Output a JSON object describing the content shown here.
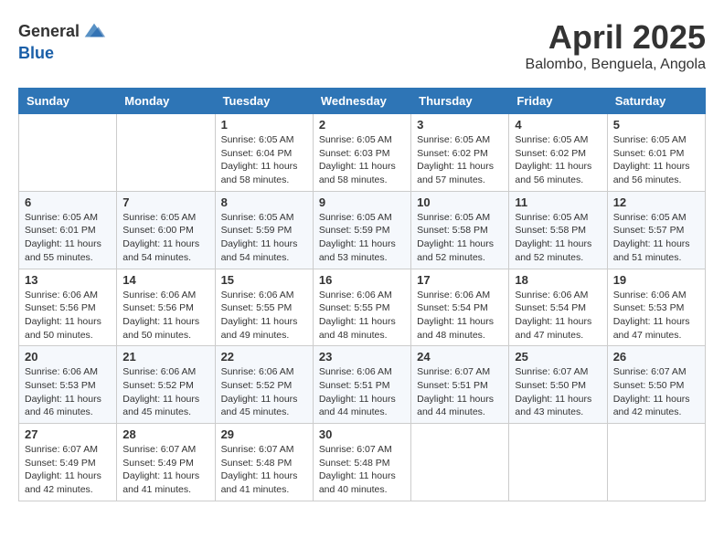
{
  "header": {
    "logo_general": "General",
    "logo_blue": "Blue",
    "month_title": "April 2025",
    "subtitle": "Balombo, Benguela, Angola"
  },
  "days_of_week": [
    "Sunday",
    "Monday",
    "Tuesday",
    "Wednesday",
    "Thursday",
    "Friday",
    "Saturday"
  ],
  "weeks": [
    [
      {
        "day": "",
        "info": ""
      },
      {
        "day": "",
        "info": ""
      },
      {
        "day": "1",
        "info": "Sunrise: 6:05 AM\nSunset: 6:04 PM\nDaylight: 11 hours and 58 minutes."
      },
      {
        "day": "2",
        "info": "Sunrise: 6:05 AM\nSunset: 6:03 PM\nDaylight: 11 hours and 58 minutes."
      },
      {
        "day": "3",
        "info": "Sunrise: 6:05 AM\nSunset: 6:02 PM\nDaylight: 11 hours and 57 minutes."
      },
      {
        "day": "4",
        "info": "Sunrise: 6:05 AM\nSunset: 6:02 PM\nDaylight: 11 hours and 56 minutes."
      },
      {
        "day": "5",
        "info": "Sunrise: 6:05 AM\nSunset: 6:01 PM\nDaylight: 11 hours and 56 minutes."
      }
    ],
    [
      {
        "day": "6",
        "info": "Sunrise: 6:05 AM\nSunset: 6:01 PM\nDaylight: 11 hours and 55 minutes."
      },
      {
        "day": "7",
        "info": "Sunrise: 6:05 AM\nSunset: 6:00 PM\nDaylight: 11 hours and 54 minutes."
      },
      {
        "day": "8",
        "info": "Sunrise: 6:05 AM\nSunset: 5:59 PM\nDaylight: 11 hours and 54 minutes."
      },
      {
        "day": "9",
        "info": "Sunrise: 6:05 AM\nSunset: 5:59 PM\nDaylight: 11 hours and 53 minutes."
      },
      {
        "day": "10",
        "info": "Sunrise: 6:05 AM\nSunset: 5:58 PM\nDaylight: 11 hours and 52 minutes."
      },
      {
        "day": "11",
        "info": "Sunrise: 6:05 AM\nSunset: 5:58 PM\nDaylight: 11 hours and 52 minutes."
      },
      {
        "day": "12",
        "info": "Sunrise: 6:05 AM\nSunset: 5:57 PM\nDaylight: 11 hours and 51 minutes."
      }
    ],
    [
      {
        "day": "13",
        "info": "Sunrise: 6:06 AM\nSunset: 5:56 PM\nDaylight: 11 hours and 50 minutes."
      },
      {
        "day": "14",
        "info": "Sunrise: 6:06 AM\nSunset: 5:56 PM\nDaylight: 11 hours and 50 minutes."
      },
      {
        "day": "15",
        "info": "Sunrise: 6:06 AM\nSunset: 5:55 PM\nDaylight: 11 hours and 49 minutes."
      },
      {
        "day": "16",
        "info": "Sunrise: 6:06 AM\nSunset: 5:55 PM\nDaylight: 11 hours and 48 minutes."
      },
      {
        "day": "17",
        "info": "Sunrise: 6:06 AM\nSunset: 5:54 PM\nDaylight: 11 hours and 48 minutes."
      },
      {
        "day": "18",
        "info": "Sunrise: 6:06 AM\nSunset: 5:54 PM\nDaylight: 11 hours and 47 minutes."
      },
      {
        "day": "19",
        "info": "Sunrise: 6:06 AM\nSunset: 5:53 PM\nDaylight: 11 hours and 47 minutes."
      }
    ],
    [
      {
        "day": "20",
        "info": "Sunrise: 6:06 AM\nSunset: 5:53 PM\nDaylight: 11 hours and 46 minutes."
      },
      {
        "day": "21",
        "info": "Sunrise: 6:06 AM\nSunset: 5:52 PM\nDaylight: 11 hours and 45 minutes."
      },
      {
        "day": "22",
        "info": "Sunrise: 6:06 AM\nSunset: 5:52 PM\nDaylight: 11 hours and 45 minutes."
      },
      {
        "day": "23",
        "info": "Sunrise: 6:06 AM\nSunset: 5:51 PM\nDaylight: 11 hours and 44 minutes."
      },
      {
        "day": "24",
        "info": "Sunrise: 6:07 AM\nSunset: 5:51 PM\nDaylight: 11 hours and 44 minutes."
      },
      {
        "day": "25",
        "info": "Sunrise: 6:07 AM\nSunset: 5:50 PM\nDaylight: 11 hours and 43 minutes."
      },
      {
        "day": "26",
        "info": "Sunrise: 6:07 AM\nSunset: 5:50 PM\nDaylight: 11 hours and 42 minutes."
      }
    ],
    [
      {
        "day": "27",
        "info": "Sunrise: 6:07 AM\nSunset: 5:49 PM\nDaylight: 11 hours and 42 minutes."
      },
      {
        "day": "28",
        "info": "Sunrise: 6:07 AM\nSunset: 5:49 PM\nDaylight: 11 hours and 41 minutes."
      },
      {
        "day": "29",
        "info": "Sunrise: 6:07 AM\nSunset: 5:48 PM\nDaylight: 11 hours and 41 minutes."
      },
      {
        "day": "30",
        "info": "Sunrise: 6:07 AM\nSunset: 5:48 PM\nDaylight: 11 hours and 40 minutes."
      },
      {
        "day": "",
        "info": ""
      },
      {
        "day": "",
        "info": ""
      },
      {
        "day": "",
        "info": ""
      }
    ]
  ]
}
